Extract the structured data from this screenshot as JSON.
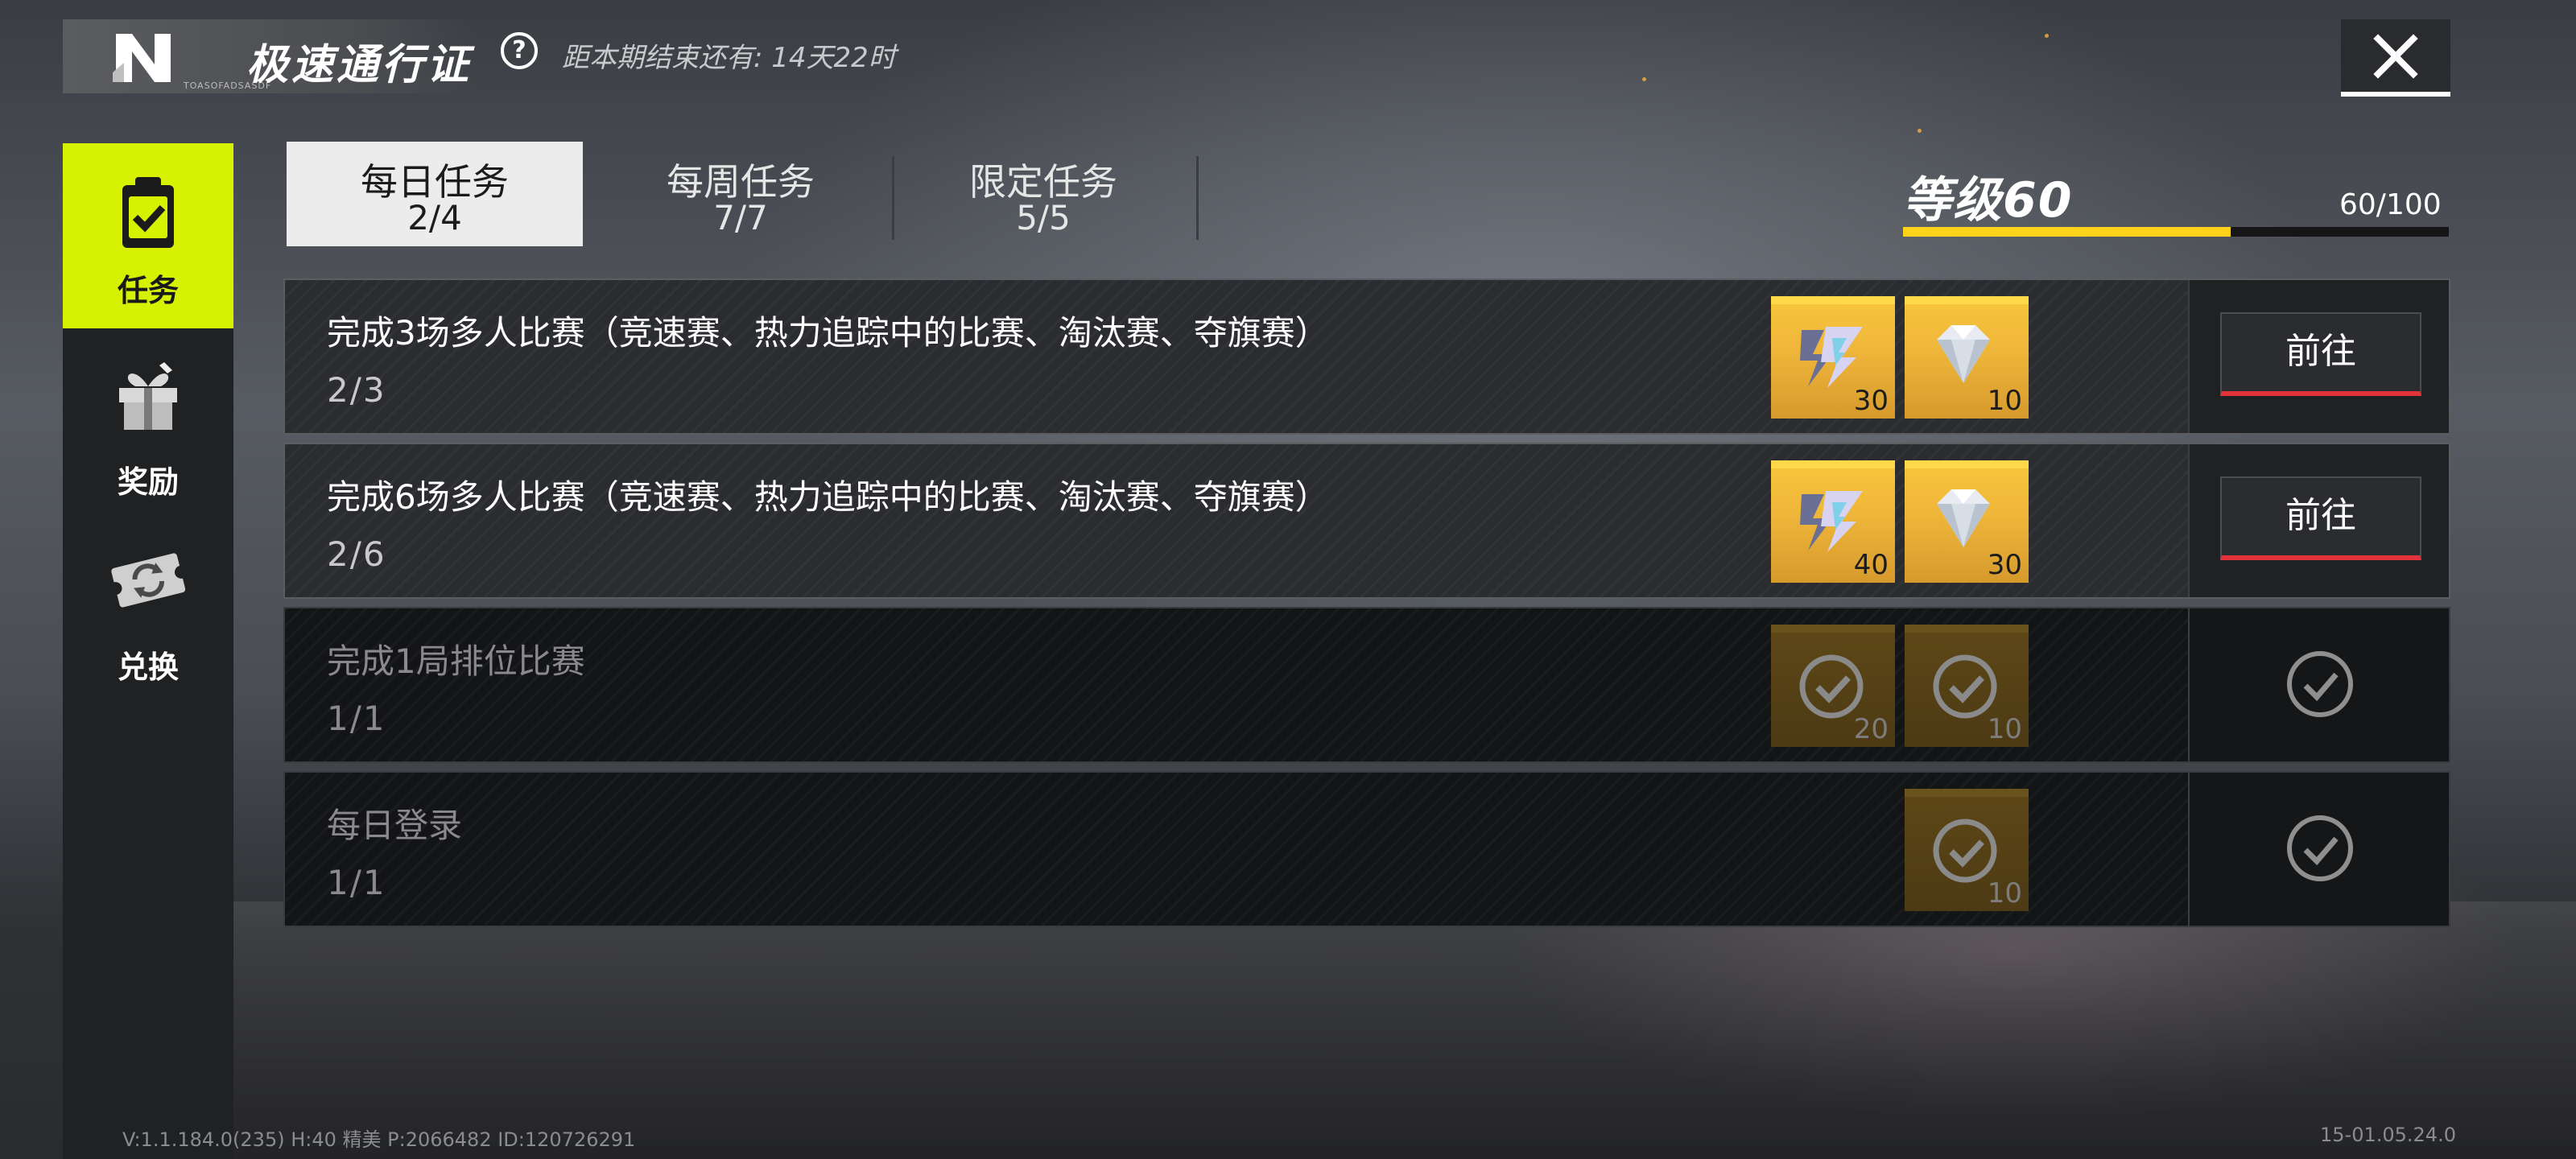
{
  "header": {
    "logo_small_text": "TOASOFADSASDF",
    "title": "极速通行证",
    "countdown": "距本期结束还有: 14天22时"
  },
  "sidebar": {
    "items": [
      {
        "label": "任务",
        "icon": "clipboard-check-icon",
        "active": true
      },
      {
        "label": "奖励",
        "icon": "gift-icon",
        "active": false
      },
      {
        "label": "兑换",
        "icon": "exchange-ticket-icon",
        "active": false
      }
    ]
  },
  "tabs": [
    {
      "label": "每日任务",
      "count": "2/4",
      "active": true
    },
    {
      "label": "每周任务",
      "count": "7/7",
      "active": false
    },
    {
      "label": "限定任务",
      "count": "5/5",
      "active": false
    }
  ],
  "level": {
    "label": "等级60",
    "progress_text": "60/100",
    "progress_fraction": 0.6,
    "bar_color": "#ffd21c"
  },
  "tasks": [
    {
      "title": "完成3场多人比赛（竞速赛、热力追踪中的比赛、淘汰赛、夺旗赛）",
      "progress": "2/3",
      "rewards": [
        {
          "icon": "pass-xp-icon",
          "qty": "30"
        },
        {
          "icon": "diamond-icon",
          "qty": "10"
        }
      ],
      "action": "前往",
      "completed": false
    },
    {
      "title": "完成6场多人比赛（竞速赛、热力追踪中的比赛、淘汰赛、夺旗赛）",
      "progress": "2/6",
      "rewards": [
        {
          "icon": "pass-xp-icon",
          "qty": "40"
        },
        {
          "icon": "diamond-icon",
          "qty": "30"
        }
      ],
      "action": "前往",
      "completed": false
    },
    {
      "title": "完成1局排位比赛",
      "progress": "1/1",
      "rewards": [
        {
          "icon": "pass-xp-icon",
          "qty": "20"
        },
        {
          "icon": "diamond-icon",
          "qty": "10"
        }
      ],
      "completed": true
    },
    {
      "title": "每日登录",
      "progress": "1/1",
      "rewards": [
        {
          "icon": "pass-xp-icon",
          "qty": "10"
        }
      ],
      "completed": true
    }
  ],
  "footer": {
    "version_left": "V:1.1.184.0(235) H:40 精美 P:2066482 ID:120726291",
    "version_right": "15-01.05.24.0"
  },
  "colors": {
    "accent": "#d7f200",
    "go_button_underline": "#e2333a",
    "reward_gold": "#f6c43b"
  }
}
